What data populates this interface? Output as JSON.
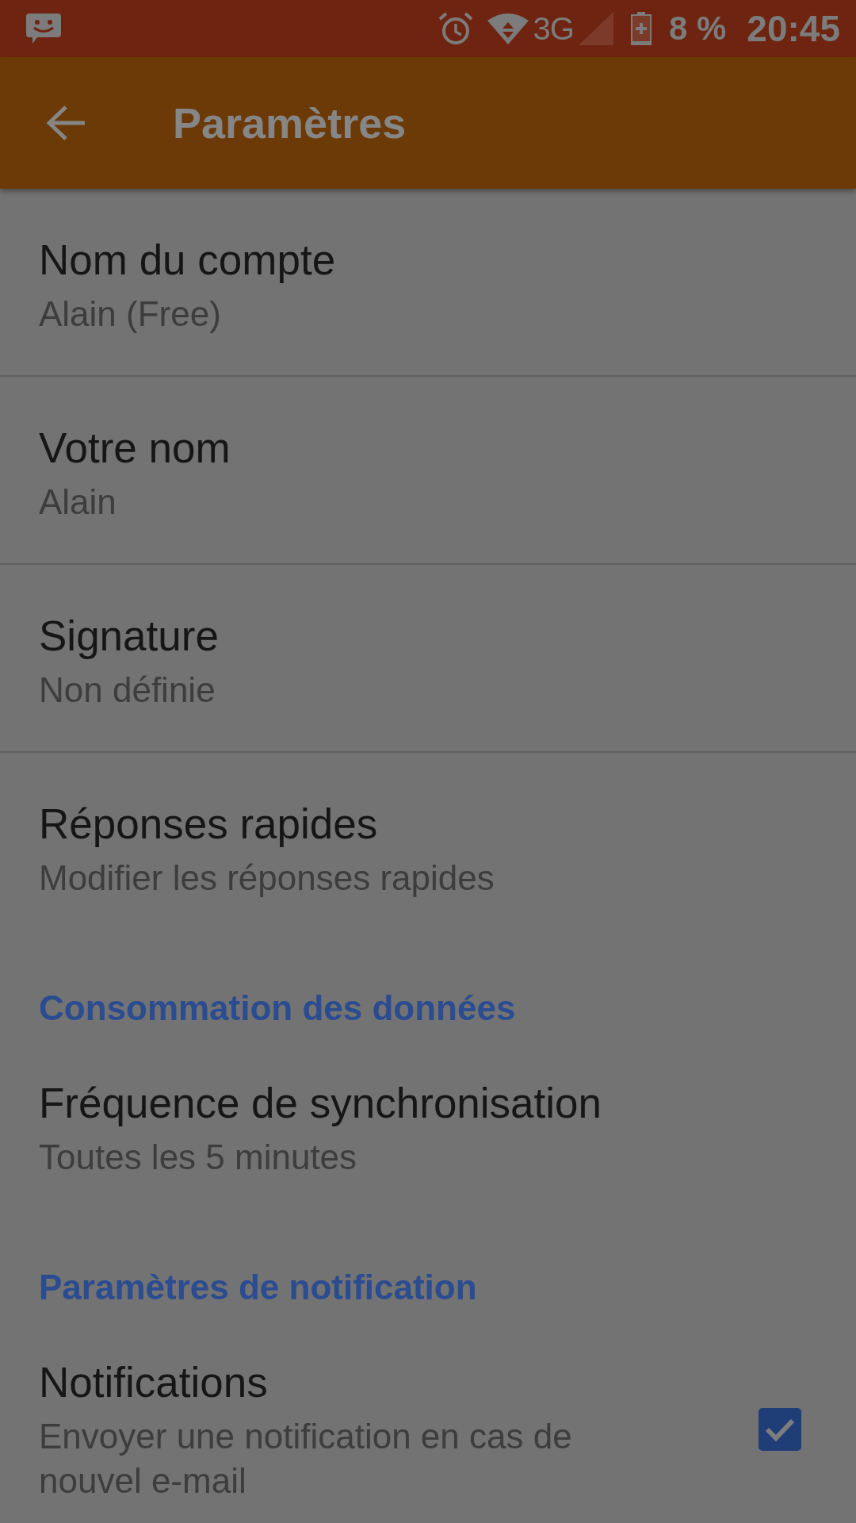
{
  "status_bar": {
    "network": "3G",
    "battery": "8 %",
    "time": "20:45"
  },
  "app_bar": {
    "title": "Paramètres"
  },
  "settings": [
    {
      "kind": "item",
      "title": "Nom du compte",
      "summary": "Alain (Free)",
      "divider": true
    },
    {
      "kind": "item",
      "title": "Votre nom",
      "summary": "Alain",
      "divider": true
    },
    {
      "kind": "item",
      "title": "Signature",
      "summary": "Non définie",
      "divider": true
    },
    {
      "kind": "item",
      "title": "Réponses rapides",
      "summary": "Modifier les réponses rapides",
      "divider": false
    },
    {
      "kind": "header",
      "title": "Consommation des données"
    },
    {
      "kind": "item",
      "title": "Fréquence de synchronisation",
      "summary": "Toutes les 5 minutes",
      "divider": false
    },
    {
      "kind": "header",
      "title": "Paramètres de notification"
    },
    {
      "kind": "checkbox",
      "title": "Notifications",
      "summary": "Envoyer une notification en cas de nouvel e-mail",
      "checked": true
    }
  ]
}
